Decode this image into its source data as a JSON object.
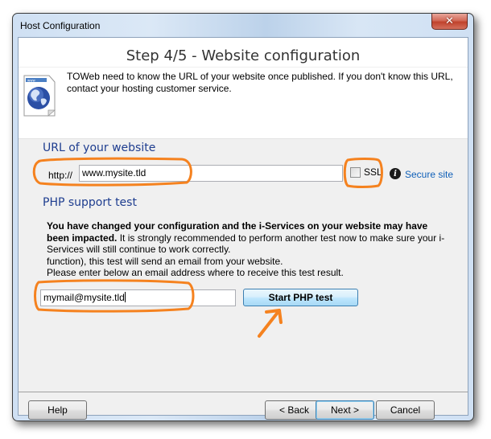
{
  "window": {
    "title": "Host Configuration",
    "close_glyph": "✕"
  },
  "header": {
    "step_title": "Step 4/5 - Website configuration",
    "intro_text": "TOWeb need to know the URL of your website once published. If you don't know this URL, contact your hosting customer service.",
    "icon": "web-page-globe-icon"
  },
  "url_section": {
    "title": "URL of your website",
    "prefix_label": "http://",
    "url_value": "www.mysite.tld",
    "ssl_label": "SSL",
    "ssl_checked": false,
    "info_glyph": "i",
    "secure_link": "Secure site"
  },
  "php_section": {
    "title": "PHP support test",
    "bold_text": "You have changed your configuration and the i-Services on your website may have been impacted.",
    "line1_rest": " It is strongly recommended to perform another test now to make sure your i-Services will still continue to work correctly.",
    "line2": "function), this test will send an email from your website.",
    "line3": "Please enter below an email address where to receive this test result.",
    "email_value": "mymail@mysite.tld",
    "start_button": "Start PHP test"
  },
  "footer": {
    "help": "Help",
    "back": "< Back",
    "next": "Next >",
    "cancel": "Cancel"
  },
  "annotations": {
    "color": "#f5821f"
  }
}
